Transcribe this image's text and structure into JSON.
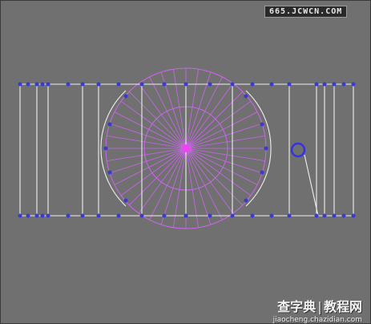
{
  "watermark_top": "665.JCWCN.COM",
  "watermark_bottom": {
    "brand_left": "查字典",
    "brand_right": "教程网",
    "url": "jiaocheng.chazidian.com"
  },
  "colors": {
    "background": "#707070",
    "wire": "#f0f0f0",
    "vertex": "#3a3ad0",
    "radial": "#cc66ee",
    "hub": "#ee44ee",
    "selection_ring": "#3333dd"
  }
}
